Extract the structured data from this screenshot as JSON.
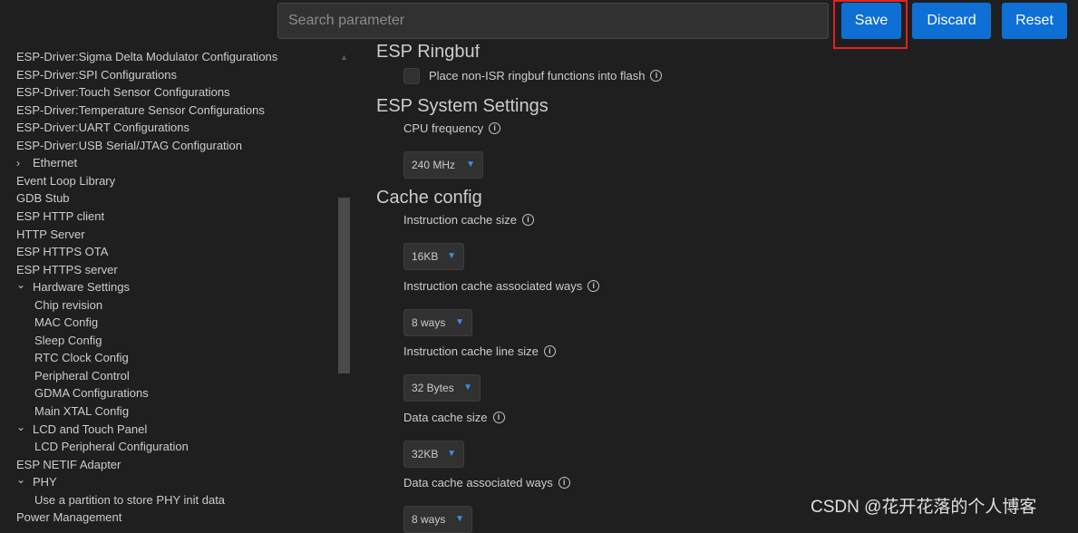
{
  "search": {
    "placeholder": "Search parameter"
  },
  "toolbar": {
    "save_label": "Save",
    "discard_label": "Discard",
    "reset_label": "Reset"
  },
  "sidebar": {
    "items": [
      {
        "label": "ESP-Driver:Sigma Delta Modulator Configurations",
        "level": 0,
        "chevron": ""
      },
      {
        "label": "ESP-Driver:SPI Configurations",
        "level": 0,
        "chevron": ""
      },
      {
        "label": "ESP-Driver:Touch Sensor Configurations",
        "level": 0,
        "chevron": ""
      },
      {
        "label": "ESP-Driver:Temperature Sensor Configurations",
        "level": 0,
        "chevron": ""
      },
      {
        "label": "ESP-Driver:UART Configurations",
        "level": 0,
        "chevron": ""
      },
      {
        "label": "ESP-Driver:USB Serial/JTAG Configuration",
        "level": 0,
        "chevron": ""
      },
      {
        "label": "Ethernet",
        "level": 0,
        "chevron": "collapsed"
      },
      {
        "label": "Event Loop Library",
        "level": 0,
        "chevron": ""
      },
      {
        "label": "GDB Stub",
        "level": 0,
        "chevron": ""
      },
      {
        "label": "ESP HTTP client",
        "level": 0,
        "chevron": ""
      },
      {
        "label": "HTTP Server",
        "level": 0,
        "chevron": ""
      },
      {
        "label": "ESP HTTPS OTA",
        "level": 0,
        "chevron": ""
      },
      {
        "label": "ESP HTTPS server",
        "level": 0,
        "chevron": ""
      },
      {
        "label": "Hardware Settings",
        "level": 0,
        "chevron": "expanded"
      },
      {
        "label": "Chip revision",
        "level": 1,
        "chevron": ""
      },
      {
        "label": "MAC Config",
        "level": 1,
        "chevron": ""
      },
      {
        "label": "Sleep Config",
        "level": 1,
        "chevron": ""
      },
      {
        "label": "RTC Clock Config",
        "level": 1,
        "chevron": ""
      },
      {
        "label": "Peripheral Control",
        "level": 1,
        "chevron": ""
      },
      {
        "label": "GDMA Configurations",
        "level": 1,
        "chevron": ""
      },
      {
        "label": "Main XTAL Config",
        "level": 1,
        "chevron": ""
      },
      {
        "label": "LCD and Touch Panel",
        "level": 0,
        "chevron": "expanded"
      },
      {
        "label": "LCD Peripheral Configuration",
        "level": 1,
        "chevron": ""
      },
      {
        "label": "ESP NETIF Adapter",
        "level": 0,
        "chevron": ""
      },
      {
        "label": "PHY",
        "level": 0,
        "chevron": "expanded"
      },
      {
        "label": "Use a partition to store PHY init data",
        "level": 1,
        "chevron": ""
      },
      {
        "label": "Power Management",
        "level": 0,
        "chevron": ""
      }
    ]
  },
  "main": {
    "ringbuf": {
      "title": "ESP Ringbuf",
      "checkbox_label": "Place non-ISR ringbuf functions into flash"
    },
    "system": {
      "title": "ESP System Settings",
      "cpu_label": "CPU frequency",
      "cpu_value": "240 MHz"
    },
    "cache": {
      "title": "Cache config",
      "icache_size_label": "Instruction cache size",
      "icache_size_value": "16KB",
      "icache_ways_label": "Instruction cache associated ways",
      "icache_ways_value": "8 ways",
      "icache_line_label": "Instruction cache line size",
      "icache_line_value": "32 Bytes",
      "dcache_size_label": "Data cache size",
      "dcache_size_value": "32KB",
      "dcache_ways_label": "Data cache associated ways",
      "dcache_ways_value": "8 ways"
    }
  },
  "watermark": "CSDN @花开花落的个人博客",
  "colors": {
    "background": "#1f1f1f",
    "button": "#0e6fd4",
    "highlight": "#e02323",
    "chevron_accent": "#3b8eea"
  },
  "icons": {
    "info": "info-icon",
    "chevron_down": "chevron-down-icon",
    "chevron_right": "chevron-right-icon"
  }
}
